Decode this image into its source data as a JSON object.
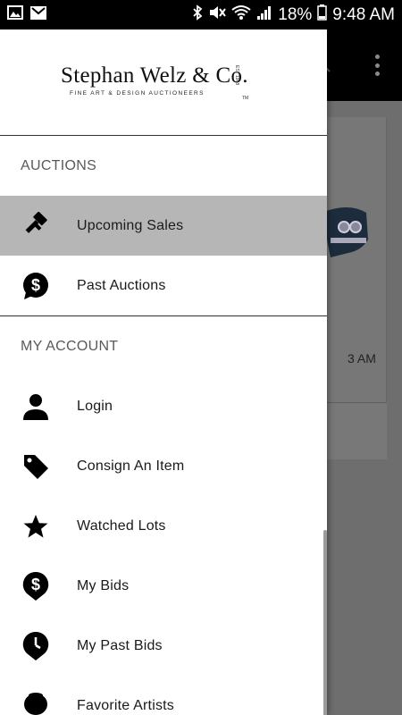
{
  "status_bar": {
    "battery": "18%",
    "time": "9:48 AM",
    "icons": [
      "image-icon",
      "gmail-icon",
      "bluetooth-icon",
      "mute-icon",
      "wifi-icon",
      "signal-icon",
      "battery-icon"
    ]
  },
  "logo": {
    "name": "Stephan Welz & Co.",
    "tagline": "FINE ART & DESIGN AUCTIONEERS",
    "est": "EST 1968",
    "tm": "TM"
  },
  "drawer": {
    "sections": [
      {
        "label": "AUCTIONS",
        "items": [
          {
            "label": "Upcoming Sales",
            "icon": "gavel-icon",
            "active": true
          },
          {
            "label": "Past Auctions",
            "icon": "dollar-bubble-icon",
            "active": false
          }
        ]
      },
      {
        "label": "MY ACCOUNT",
        "items": [
          {
            "label": "Login",
            "icon": "person-icon"
          },
          {
            "label": "Consign An Item",
            "icon": "tag-icon"
          },
          {
            "label": "Watched Lots",
            "icon": "star-icon"
          },
          {
            "label": "My Bids",
            "icon": "dollar-pin-icon"
          },
          {
            "label": "My Past Bids",
            "icon": "clock-pin-icon"
          },
          {
            "label": "Favorite Artists",
            "icon": "artist-icon"
          }
        ]
      }
    ]
  },
  "background": {
    "time_label": "3 AM"
  }
}
